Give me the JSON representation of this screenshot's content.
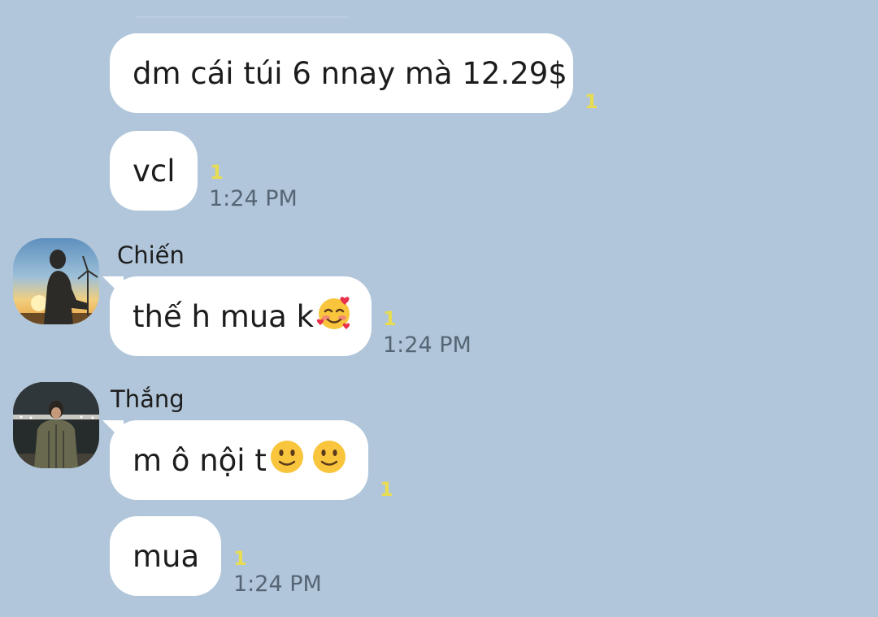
{
  "messages": [
    {
      "text": "dm cái túi 6 nnay mà 12.29$",
      "read_count": "1"
    },
    {
      "text": "vcl",
      "read_count": "1",
      "time": "1:24 PM"
    },
    {
      "sender": "Chiến",
      "text": "thế h mua k",
      "emoji": "smiling-face-with-hearts",
      "read_count": "1",
      "time": "1:24 PM"
    },
    {
      "sender": "Thắng",
      "text": "m ô nội t",
      "emoji": "slightly-smiling-face",
      "read_count": "1"
    },
    {
      "text": "mua",
      "read_count": "1",
      "time": "1:24 PM"
    }
  ],
  "colors": {
    "background": "#b1c6da",
    "bubble": "#ffffff",
    "read_count": "#e8dc52",
    "time": "#566575"
  }
}
